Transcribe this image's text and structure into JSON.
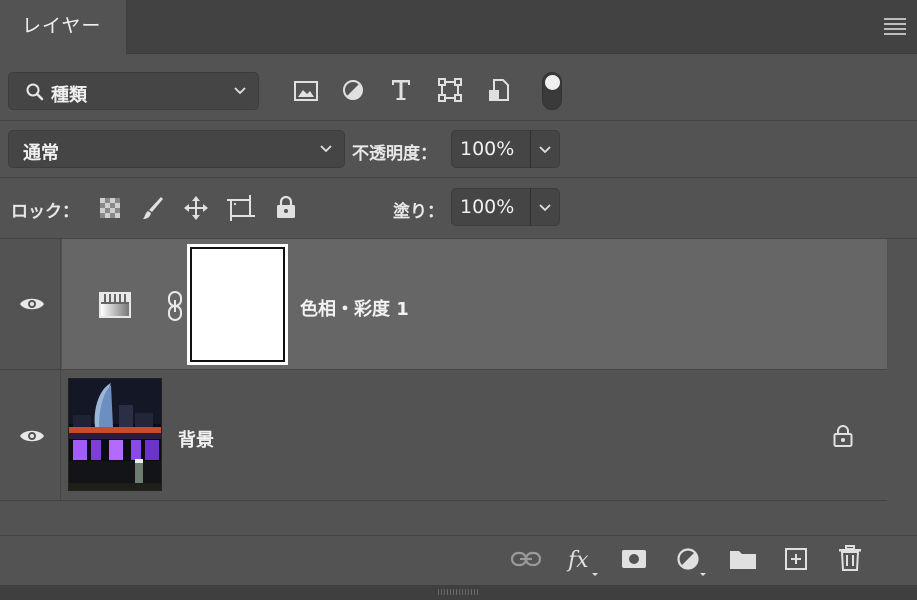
{
  "panel": {
    "tab_label": "レイヤー"
  },
  "filter": {
    "selected": "種類"
  },
  "blend": {
    "mode": "通常",
    "opacity_label": "不透明度：",
    "opacity_value": "100%"
  },
  "lock": {
    "label": "ロック：",
    "fill_label": "塗り：",
    "fill_value": "100%"
  },
  "layers": [
    {
      "name": "色相・彩度 1",
      "type": "adjustment",
      "selected": true,
      "visible": true
    },
    {
      "name": "背景",
      "type": "image",
      "selected": false,
      "visible": true,
      "locked": true
    }
  ],
  "colors": {
    "panel_bg": "#535353",
    "selected_row": "#666666",
    "header_bg": "#424242"
  }
}
